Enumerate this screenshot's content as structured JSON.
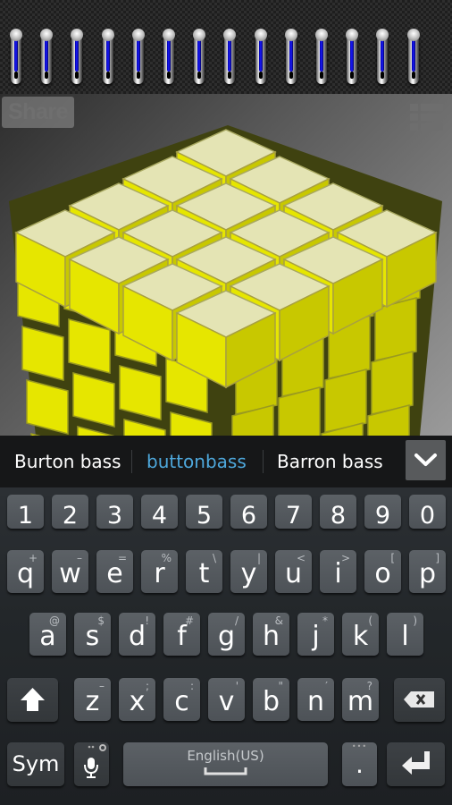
{
  "top_bar": {
    "sliders": [
      {
        "name": "slider-1",
        "level": 0.82
      },
      {
        "name": "slider-2",
        "level": 0.82
      },
      {
        "name": "slider-3",
        "level": 0.82
      },
      {
        "name": "slider-4",
        "level": 0.82
      },
      {
        "name": "slider-5",
        "level": 0.82
      },
      {
        "name": "slider-6",
        "level": 0.82
      },
      {
        "name": "slider-7",
        "level": 0.82
      },
      {
        "name": "slider-8",
        "level": 0.82
      },
      {
        "name": "slider-9",
        "level": 0.82
      },
      {
        "name": "slider-10",
        "level": 0.82
      },
      {
        "name": "slider-11",
        "level": 0.82
      },
      {
        "name": "slider-12",
        "level": 0.82
      },
      {
        "name": "slider-13",
        "level": 0.82
      },
      {
        "name": "slider-14",
        "level": 0.82
      }
    ],
    "slider_fill_color": "#1a1aff"
  },
  "stage": {
    "share_label": "Share",
    "menu_icon": "list-menu-icon",
    "image": "yellow-glass-cube",
    "cube_color": "#e6e600"
  },
  "suggestions": {
    "items": [
      {
        "label": "Burton bass",
        "active": false
      },
      {
        "label": "buttonbass",
        "active": true
      },
      {
        "label": "Barron bass",
        "active": false
      }
    ],
    "active_color": "#4ea8dc",
    "expand_icon": "chevron-down-icon"
  },
  "keyboard": {
    "number_row": [
      "1",
      "2",
      "3",
      "4",
      "5",
      "6",
      "7",
      "8",
      "9",
      "0"
    ],
    "row1": [
      {
        "k": "q",
        "alt": "+"
      },
      {
        "k": "w",
        "alt": "–"
      },
      {
        "k": "e",
        "alt": "="
      },
      {
        "k": "r",
        "alt": "%"
      },
      {
        "k": "t",
        "alt": "\\"
      },
      {
        "k": "y",
        "alt": "|"
      },
      {
        "k": "u",
        "alt": "<"
      },
      {
        "k": "i",
        "alt": ">"
      },
      {
        "k": "o",
        "alt": "["
      },
      {
        "k": "p",
        "alt": "]"
      }
    ],
    "row2": [
      {
        "k": "a",
        "alt": "@"
      },
      {
        "k": "s",
        "alt": "$"
      },
      {
        "k": "d",
        "alt": "!"
      },
      {
        "k": "f",
        "alt": "#"
      },
      {
        "k": "g",
        "alt": "/"
      },
      {
        "k": "h",
        "alt": "&"
      },
      {
        "k": "j",
        "alt": "*"
      },
      {
        "k": "k",
        "alt": "("
      },
      {
        "k": "l",
        "alt": ")"
      }
    ],
    "row3": [
      {
        "k": "z",
        "alt": "–"
      },
      {
        "k": "x",
        "alt": ";"
      },
      {
        "k": "c",
        "alt": ":"
      },
      {
        "k": "v",
        "alt": "'"
      },
      {
        "k": "b",
        "alt": "\""
      },
      {
        "k": "n",
        "alt": "′"
      },
      {
        "k": "m",
        "alt": "?"
      }
    ],
    "shift_icon": "shift-arrow-icon",
    "backspace_icon": "backspace-icon",
    "sym_label": "Sym",
    "voice_icon": "microphone-icon",
    "space_label": "English(US)",
    "period_label": ".",
    "period_more": "•••",
    "enter_icon": "enter-icon"
  }
}
